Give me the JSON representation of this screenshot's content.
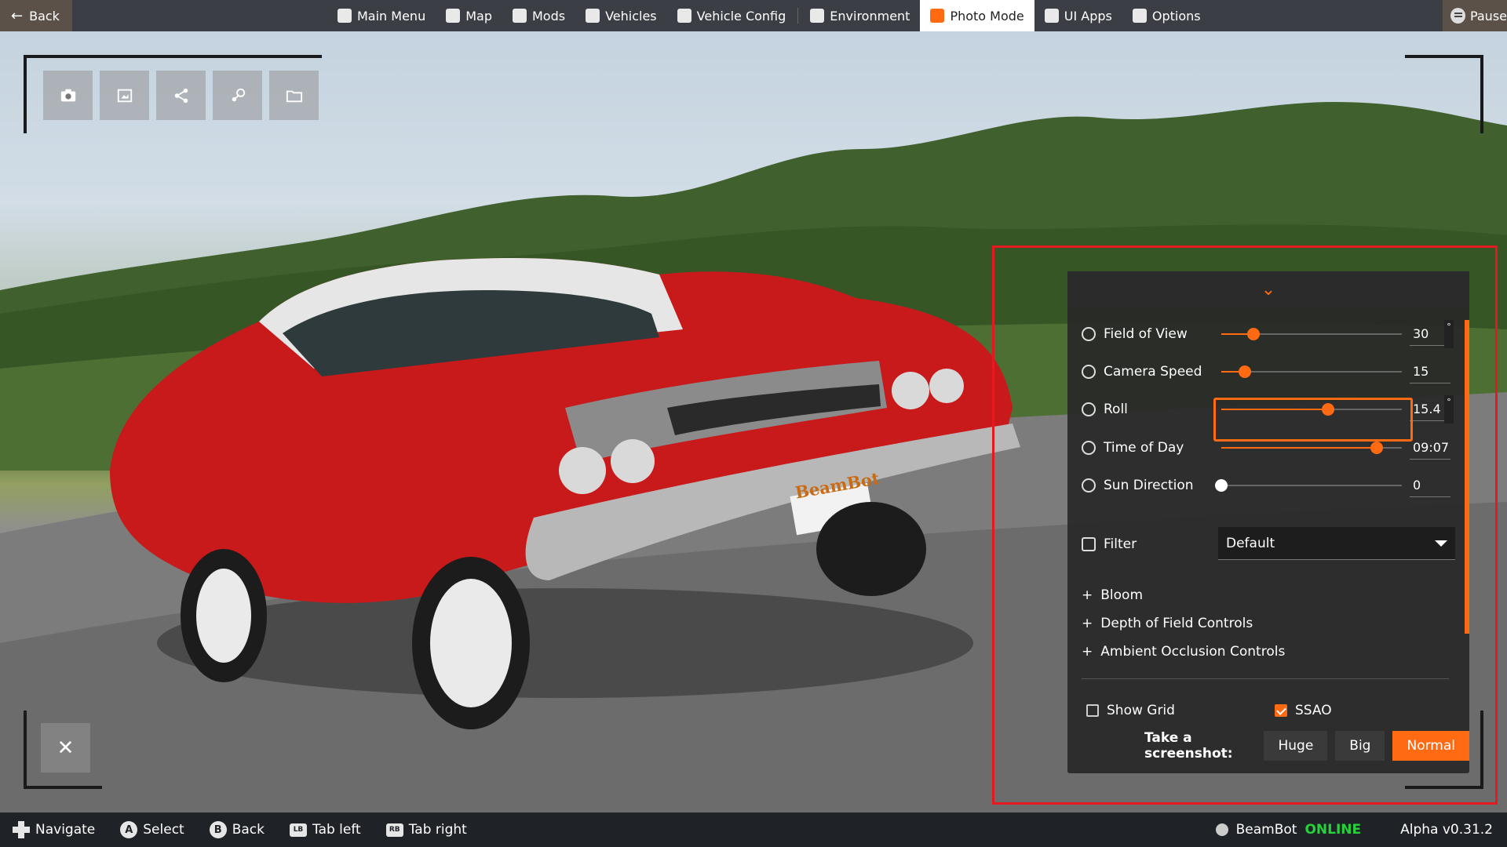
{
  "topbar": {
    "back": "Back",
    "items": [
      {
        "label": "Main Menu",
        "icon": "main-menu-icon"
      },
      {
        "label": "Map",
        "icon": "map-icon"
      },
      {
        "label": "Mods",
        "icon": "puzzle-icon"
      },
      {
        "label": "Vehicles",
        "icon": "car-icon"
      },
      {
        "label": "Vehicle Config",
        "icon": "engine-icon"
      },
      {
        "label": "Environment",
        "icon": "weather-icon"
      },
      {
        "label": "Photo Mode",
        "icon": "camera-icon",
        "active": true
      },
      {
        "label": "UI Apps",
        "icon": "ui-apps-icon"
      },
      {
        "label": "Options",
        "icon": "sliders-icon"
      }
    ],
    "pause": "Pause"
  },
  "scene": {
    "plate": "BeamBot"
  },
  "photo_tools": [
    "camera-icon",
    "frame-icon",
    "share-icon",
    "steam-icon",
    "folder-icon"
  ],
  "panel": {
    "collapse_icon": "chevron-down-icon",
    "sliders": [
      {
        "label": "Field of View",
        "value": "30",
        "unit": "°",
        "level": 0.18
      },
      {
        "label": "Camera Speed",
        "value": "15",
        "unit": "",
        "level": 0.13
      },
      {
        "label": "Roll",
        "value": "15.4",
        "unit": "°",
        "level": 0.59
      },
      {
        "label": "Time of Day",
        "value": "09:07",
        "unit": "",
        "level": 0.86
      },
      {
        "label": "Sun Direction",
        "value": "0",
        "unit": "",
        "level": 0.0
      }
    ],
    "filter": {
      "label": "Filter",
      "value": "Default"
    },
    "expanders": [
      "Bloom",
      "Depth of Field Controls",
      "Ambient Occlusion Controls"
    ],
    "show_grid": {
      "label": "Show Grid",
      "checked": false
    },
    "ssao": {
      "label": "SSAO",
      "checked": true
    },
    "screenshot": {
      "label": "Take a screenshot:",
      "options": [
        "Huge",
        "Big",
        "Normal"
      ],
      "selected": "Normal"
    }
  },
  "bottombar": {
    "hints": [
      {
        "glyph": "dpad",
        "label": "Navigate"
      },
      {
        "glyph": "A",
        "label": "Select"
      },
      {
        "glyph": "B",
        "label": "Back"
      },
      {
        "glyph": "LB",
        "label": "Tab left"
      },
      {
        "glyph": "RB",
        "label": "Tab right"
      }
    ],
    "user": "BeamBot",
    "status": "ONLINE",
    "version": "Alpha v0.31.2"
  },
  "colors": {
    "accent": "#ff6a13",
    "highlight": "#e5191f",
    "online": "#27d13b"
  }
}
